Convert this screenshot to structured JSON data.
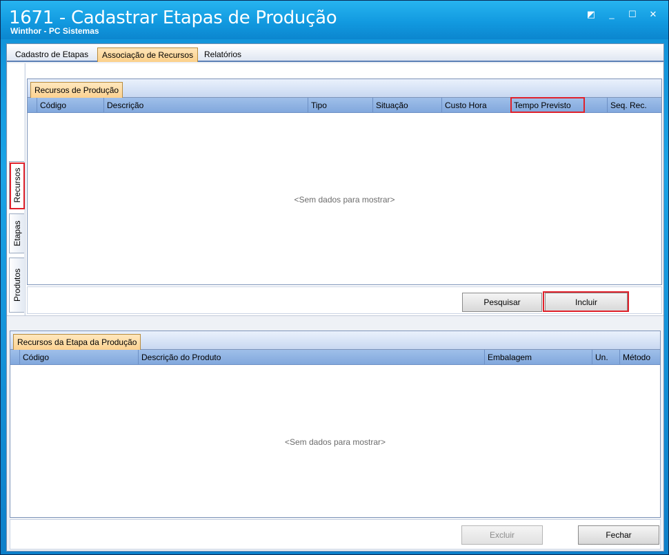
{
  "window": {
    "title": "1671 - Cadastrar Etapas de Produção",
    "subtitle": "Winthor - PC Sistemas",
    "controls": [
      "◩",
      "_",
      "☐",
      "✕"
    ]
  },
  "tabs": [
    "Cadastro de Etapas",
    "Associação de Recursos",
    "Relatórios"
  ],
  "active_tab": "Associação de Recursos",
  "side_tabs": [
    "Recursos",
    "Etapas",
    "Produtos"
  ],
  "active_side_tab": "Recursos",
  "resources_panel": {
    "tab_label": "Recursos de Produção",
    "columns": [
      "Código",
      "Descrição",
      "Tipo",
      "Situação",
      "Custo Hora",
      "Tempo Previsto",
      "Seq. Rec."
    ],
    "empty_text": "<Sem dados para mostrar>",
    "search_button": "Pesquisar",
    "include_button": "Incluir"
  },
  "stage_resources_panel": {
    "tab_label": "Recursos da Etapa da Produção",
    "columns": [
      "Código",
      "Descrição do Produto",
      "Embalagem",
      "Un.",
      "Método"
    ],
    "empty_text": "<Sem dados para mostrar>"
  },
  "footer": {
    "delete_button": "Excluir",
    "close_button": "Fechar"
  },
  "highlight_color": "#e0202a"
}
